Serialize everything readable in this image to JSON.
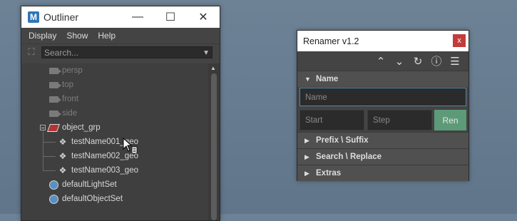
{
  "outliner": {
    "logo": "M",
    "title": "Outliner",
    "controls": [
      "minimize-icon",
      "maximize-icon",
      "close-icon"
    ],
    "menu": [
      "Display",
      "Show",
      "Help"
    ],
    "search": {
      "placeholder": "Search..."
    },
    "items": {
      "persp": "persp",
      "top": "top",
      "front": "front",
      "side": "side",
      "object_grp": "object_grp",
      "geo1": "testName001_geo",
      "geo2": "testName002_geo",
      "geo3": "testName003_geo",
      "lightset": "defaultLightSet",
      "objectset": "defaultObjectSet"
    }
  },
  "renamer": {
    "title": "Renamer v1.2",
    "close": "x",
    "toolbar_icons": [
      "chevron-up-icon",
      "chevron-down-icon",
      "refresh-icon",
      "help-icon",
      "menu-icon"
    ],
    "name_section": "Name",
    "name_placeholder": "Name",
    "start_placeholder": "Start",
    "step_placeholder": "Step",
    "ren_button": "Ren",
    "prefix_section": "Prefix \\ Suffix",
    "search_section": "Search \\ Replace",
    "extras_section": "Extras",
    "accent_color": "#5d9a78",
    "close_color": "#c43b3b"
  }
}
